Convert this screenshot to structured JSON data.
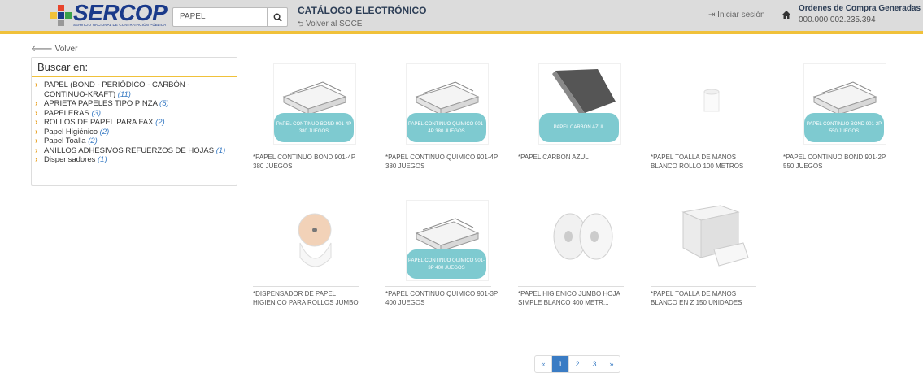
{
  "brand": {
    "name": "SERCOP",
    "subtitle": "SERVICIO NACIONAL DE CONTRATACIÓN PÚBLICA",
    "colors": {
      "primary": "#1a3a8a",
      "accent": "#f0c13a",
      "link": "#3a7cc4",
      "pill": "#7ecad0"
    }
  },
  "header": {
    "search_value": "PAPEL",
    "search_icon": "search-icon",
    "catalog_title": "CATÁLOGO ELECTRÓNICO",
    "back_soce": "Volver al SOCE",
    "login": "Iniciar sesión",
    "orders_title": "Ordenes de Compra Generadas",
    "orders_value": "000.000.002.235.394"
  },
  "sidebar": {
    "back": "Volver",
    "title": "Buscar en:",
    "items": [
      {
        "label": "PAPEL (BOND - PERIÓDICO - CARBÓN - CONTINUO-KRAFT)",
        "count": "(11)"
      },
      {
        "label": "APRIETA PAPELES TIPO PINZA",
        "count": "(5)"
      },
      {
        "label": "PAPELERAS",
        "count": "(3)"
      },
      {
        "label": "ROLLOS DE PAPEL PARA FAX",
        "count": "(2)"
      },
      {
        "label": "Papel Higiénico",
        "count": "(2)"
      },
      {
        "label": "Papel Toalla",
        "count": "(2)"
      },
      {
        "label": "ANILLOS ADHESIVOS REFUERZOS DE HOJAS",
        "count": "(1)"
      },
      {
        "label": "Dispensadores",
        "count": "(1)"
      }
    ]
  },
  "products": [
    {
      "name": "*PAPEL CONTINUO BOND 901-4P 380 JUEGOS",
      "image": "paper-box-image",
      "pill": "PAPEL CONTINUO BOND 901-4P 380 JUEGOS"
    },
    {
      "name": "*PAPEL CONTINUO QUIMICO 901-4P 380 JUEGOS",
      "image": "paper-box-image",
      "pill": "PAPEL CONTINUO QUIMICO 901-4P 380 JUEGOS"
    },
    {
      "name": "*PAPEL CARBON AZUL",
      "image": "carbon-paper-image",
      "pill": "PAPEL CARBON AZUL"
    },
    {
      "name": "*PAPEL TOALLA DE MANOS BLANCO ROLLO 100 METROS",
      "image": "towel-roll-image",
      "pill": ""
    },
    {
      "name": "*PAPEL CONTINUO BOND 901-2P 550 JUEGOS",
      "image": "paper-box-image",
      "pill": "PAPEL CONTINUO BOND 901-2P 550 JUEGOS"
    },
    {
      "name": "*DISPENSADOR DE PAPEL HIGIENICO PARA ROLLOS JUMBO",
      "image": "dispenser-image",
      "pill": ""
    },
    {
      "name": "*PAPEL CONTINUO QUIMICO 901-3P 400 JUEGOS",
      "image": "paper-box-image",
      "pill": "PAPEL CONTINUO QUIMICO 901-3P 400 JUEGOS"
    },
    {
      "name": "*PAPEL HIGIENICO JUMBO HOJA SIMPLE BLANCO 400 METR...",
      "image": "jumbo-rolls-image",
      "pill": ""
    },
    {
      "name": "*PAPEL TOALLA DE MANOS BLANCO EN Z 150 UNIDADES",
      "image": "z-towels-image",
      "pill": ""
    }
  ],
  "pagination": {
    "prev": "«",
    "pages": [
      "1",
      "2",
      "3"
    ],
    "current": "1",
    "next": "»"
  }
}
